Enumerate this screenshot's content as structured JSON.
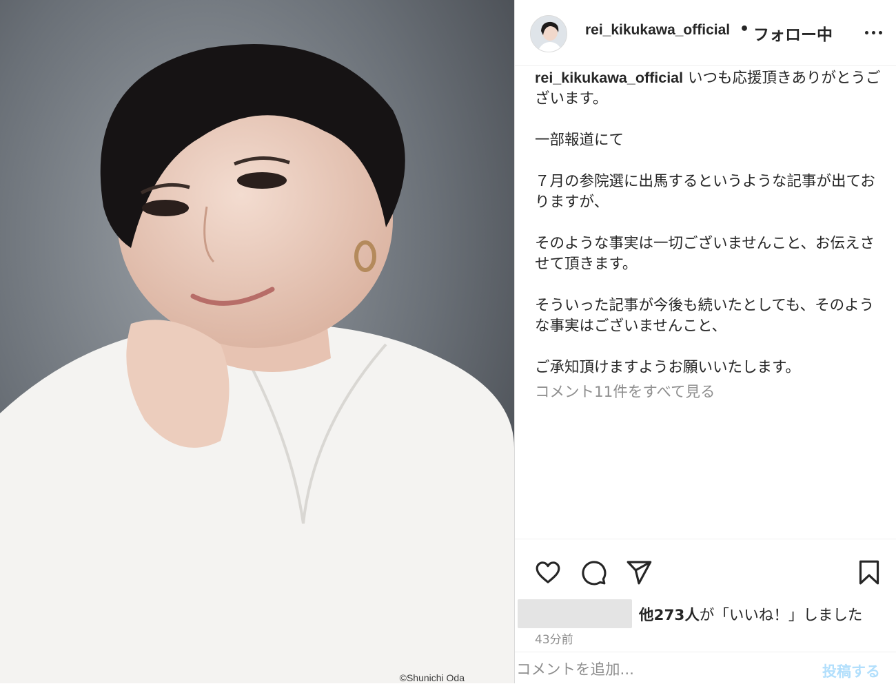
{
  "photo": {
    "credit": "©Shunichi Oda"
  },
  "header": {
    "username": "rei_kikukawa_official",
    "separator": "•",
    "follow_status": "フォロー中",
    "more_icon": "more-horizontal-icon"
  },
  "caption": {
    "username": "rei_kikukawa_official",
    "lines": [
      "いつも応援頂きありがとうございます。",
      "一部報道にて",
      "７月の参院選に出馬するというような記事が出ておりますが、",
      "そのような事実は一切ございませんこと、お伝えさせて頂きます。",
      "そういった記事が今後も続いたとしても、そのような事実はございませんこと、",
      "ご承知頂けますようお願いいたします。"
    ]
  },
  "comments": {
    "view_all": "コメント11件をすべて見る"
  },
  "actions": {
    "like_icon": "heart-icon",
    "comment_icon": "comment-bubble-icon",
    "share_icon": "paper-plane-icon",
    "save_icon": "bookmark-icon"
  },
  "likes": {
    "count_text": "他273人",
    "suffix": "が「いいね！」しました"
  },
  "timestamp": "43分前",
  "comment_box": {
    "placeholder": "コメントを追加...",
    "post_label": "投稿する"
  },
  "colors": {
    "text": "#262626",
    "muted": "#8e8e8e",
    "post_disabled": "#b2dffc",
    "border": "#dbdbdb"
  }
}
